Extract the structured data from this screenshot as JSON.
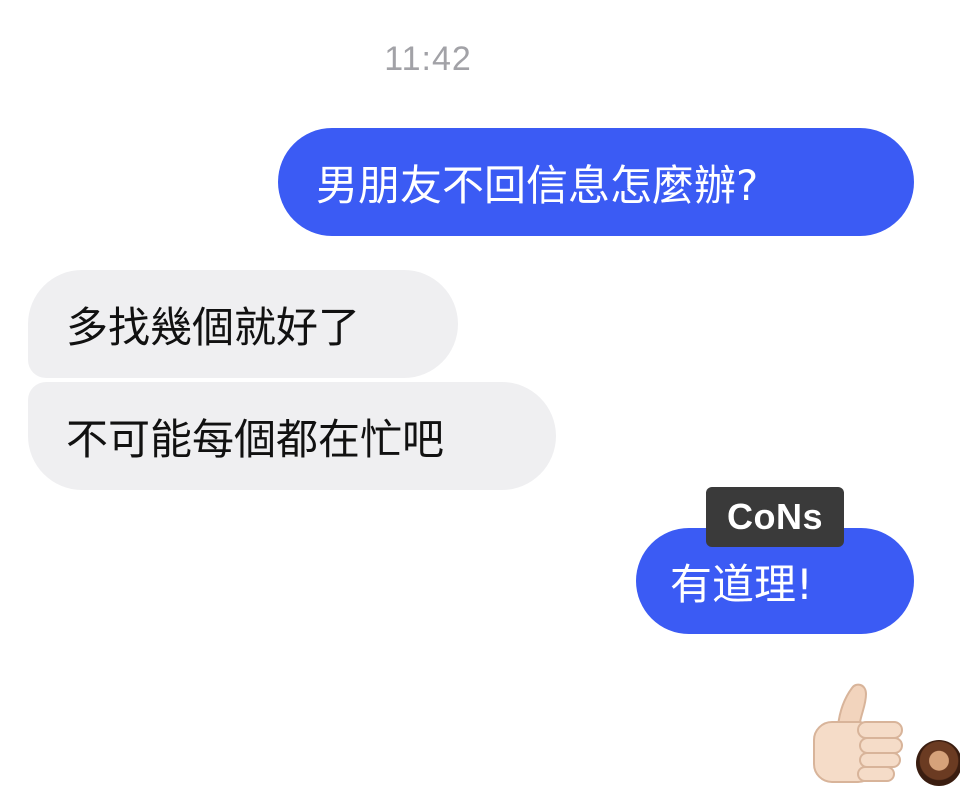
{
  "chat": {
    "timestamp": "11:42",
    "messages": [
      {
        "direction": "outgoing",
        "text": "男朋友不回信息怎麼辦?"
      },
      {
        "direction": "incoming",
        "text": "多找幾個就好了"
      },
      {
        "direction": "incoming",
        "text": "不可能每個都在忙吧"
      },
      {
        "direction": "outgoing",
        "text": "有道理!"
      }
    ],
    "reaction": {
      "icon": "thumbs-up-icon"
    },
    "avatar": {
      "icon": "contact-avatar"
    }
  },
  "watermark": {
    "text": "CoNs"
  },
  "colors": {
    "outgoing_bubble": "#3b5bf4",
    "incoming_bubble": "#efeff1",
    "timestamp": "#a2a2a7"
  }
}
